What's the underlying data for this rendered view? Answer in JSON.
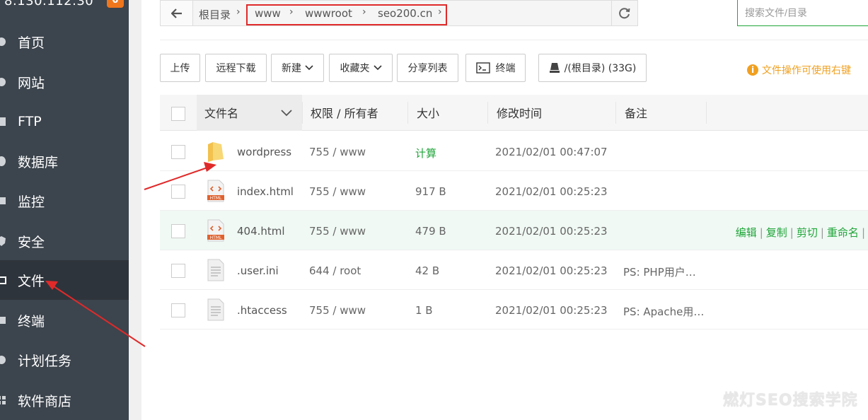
{
  "sidebar": {
    "ip": "8.130.112.30",
    "badge": "0",
    "items": [
      {
        "label": "首页"
      },
      {
        "label": "网站"
      },
      {
        "label": "FTP"
      },
      {
        "label": "数据库"
      },
      {
        "label": "监控"
      },
      {
        "label": "安全"
      },
      {
        "label": "文件"
      },
      {
        "label": "终端"
      },
      {
        "label": "计划任务"
      },
      {
        "label": "软件商店"
      }
    ],
    "active": "文件"
  },
  "path": {
    "root": "根目录",
    "segments": [
      "www",
      "wwwroot",
      "seo200.cn"
    ]
  },
  "search": {
    "placeholder": "搜索文件/目录"
  },
  "toolbar": {
    "upload": "上传",
    "remote_download": "远程下载",
    "new": "新建",
    "favorites": "收藏夹",
    "share_list": "分享列表",
    "terminal": "终端",
    "disk": "/(根目录) (33G)",
    "hint": "文件操作可使用右键"
  },
  "table": {
    "headers": {
      "name": "文件名",
      "perm": "权限 / 所有者",
      "size": "大小",
      "mtime": "修改时间",
      "note": "备注"
    },
    "rows": [
      {
        "name": "wordpress",
        "perm": "755 / www",
        "size": "计算",
        "mtime": "2021/02/01 00:47:07",
        "note": "",
        "type": "folder"
      },
      {
        "name": "index.html",
        "perm": "755 / www",
        "size": "917 B",
        "mtime": "2021/02/01 00:25:23",
        "note": "",
        "type": "html"
      },
      {
        "name": "404.html",
        "perm": "755 / www",
        "size": "479 B",
        "mtime": "2021/02/01 00:25:23",
        "note": "",
        "type": "html"
      },
      {
        "name": ".user.ini",
        "perm": "644 / root",
        "size": "42 B",
        "mtime": "2021/02/01 00:25:23",
        "note": "PS: PHP用户…",
        "type": "file"
      },
      {
        "name": ".htaccess",
        "perm": "755 / www",
        "size": "1 B",
        "mtime": "2021/02/01 00:25:23",
        "note": "PS: Apache用…",
        "type": "file"
      }
    ],
    "row_ops": [
      "编辑",
      "复制",
      "剪切",
      "重命名"
    ]
  },
  "watermark": "燃灯SEO搜索学院",
  "colors": {
    "accent": "#20a53a",
    "sidebar": "#3c444d",
    "highlight": "#e02a2a",
    "warning": "#f0a020"
  }
}
